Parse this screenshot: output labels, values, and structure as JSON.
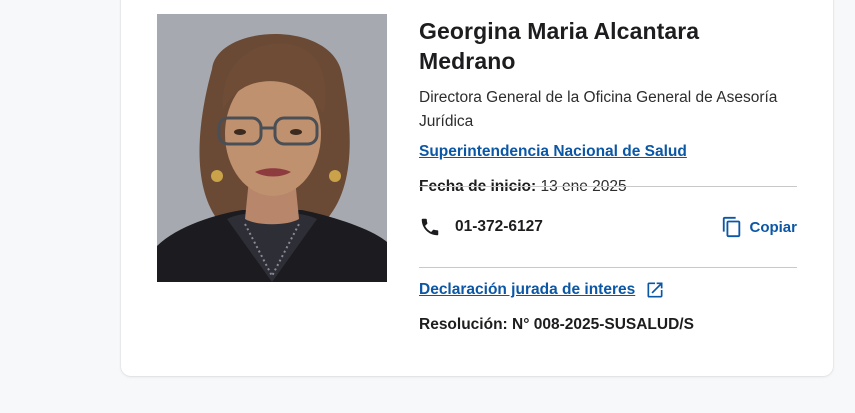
{
  "profile": {
    "name": "Georgina Maria Alcantara Medrano",
    "role": "Directora General de la Oficina General de Asesoría Jurídica",
    "organization": "Superintendencia Nacional de Salud",
    "start_date_label": "Fecha de inicio:",
    "start_date_value": "13 ene 2025",
    "phone": "01-372-6127",
    "copy_label": "Copiar",
    "declaration_link": "Declaración jurada de interes",
    "resolution": "Resolución: N° 008-2025-SUSALUD/S"
  },
  "icons": {
    "phone": "phone-icon",
    "copy": "copy-icon",
    "external": "external-link-icon"
  },
  "colors": {
    "link": "#0b57a6",
    "text": "#1d1d1f",
    "divider": "#c9c9c9"
  }
}
